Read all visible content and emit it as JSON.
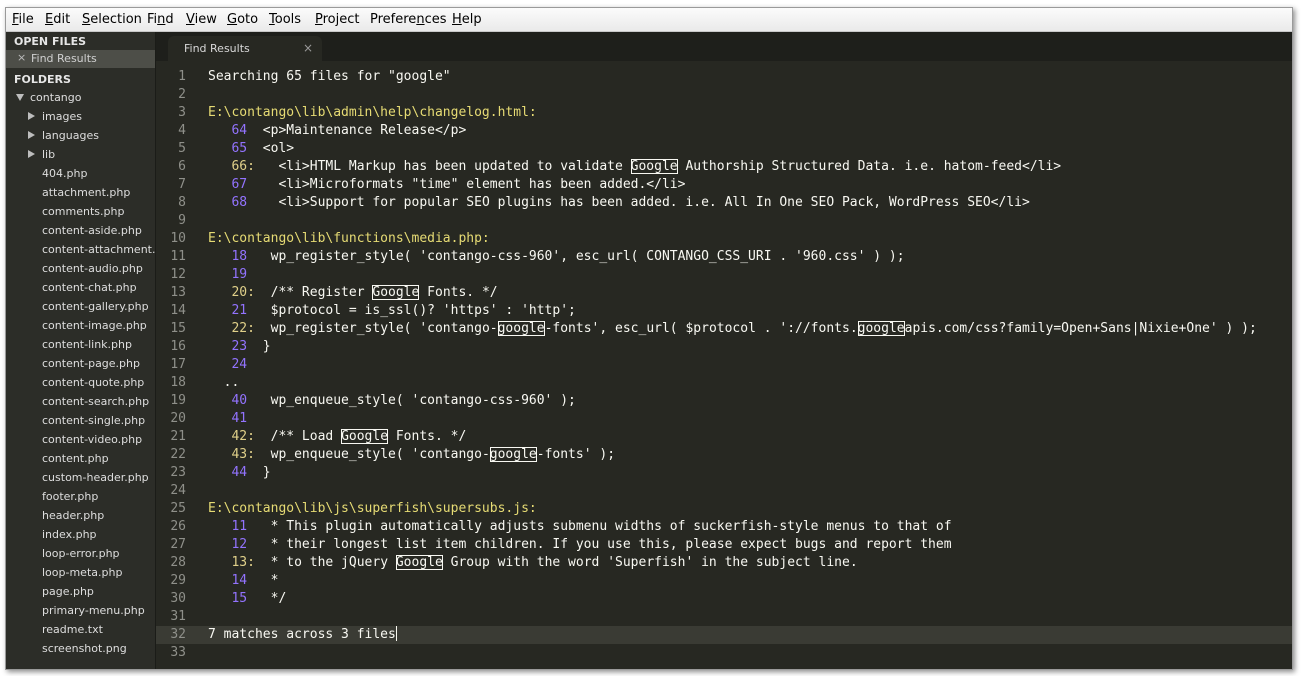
{
  "menubar": {
    "items": [
      "File",
      "Edit",
      "Selection",
      "Find",
      "View",
      "Goto",
      "Tools",
      "Project",
      "Preferences",
      "Help"
    ],
    "mnemonics": [
      "F",
      "E",
      "S",
      "n",
      "V",
      "G",
      "T",
      "P",
      "n",
      "H"
    ]
  },
  "sidebar": {
    "open_files_header": "OPEN FILES",
    "open_files": [
      {
        "close": "×",
        "name": "Find Results"
      }
    ],
    "folders_header": "FOLDERS",
    "root_folder": "contango",
    "subfolders": [
      "images",
      "languages",
      "lib"
    ],
    "files": [
      "404.php",
      "attachment.php",
      "comments.php",
      "content-aside.php",
      "content-attachment.php",
      "content-audio.php",
      "content-chat.php",
      "content-gallery.php",
      "content-image.php",
      "content-link.php",
      "content-page.php",
      "content-quote.php",
      "content-search.php",
      "content-single.php",
      "content-video.php",
      "content.php",
      "custom-header.php",
      "footer.php",
      "header.php",
      "index.php",
      "loop-error.php",
      "loop-meta.php",
      "page.php",
      "primary-menu.php",
      "readme.txt",
      "screenshot.png"
    ]
  },
  "tab": {
    "title": "Find Results",
    "close": "×"
  },
  "editor": {
    "current_line": 32,
    "colors": {
      "background": "#272822",
      "text": "#f8f8f2",
      "line_number": "#8f908a",
      "path": "#e6db74",
      "context_number": "#9373ff",
      "match_number": "#e0d08a",
      "current_line": "#3a3b34"
    },
    "lines": [
      {
        "n": "1",
        "t": [
          [
            "t",
            "Searching 65 files for \"google\""
          ]
        ]
      },
      {
        "n": "2",
        "t": []
      },
      {
        "n": "3",
        "t": [
          [
            "p",
            "E:\\contango\\lib\\admin\\help\\changelog.html:"
          ]
        ]
      },
      {
        "n": "4",
        "t": [
          [
            "c",
            "   64"
          ],
          [
            "t",
            "  <p>Maintenance Release</p>"
          ]
        ]
      },
      {
        "n": "5",
        "t": [
          [
            "c",
            "   65"
          ],
          [
            "t",
            "  <ol>"
          ]
        ]
      },
      {
        "n": "6",
        "t": [
          [
            "m",
            "   66:"
          ],
          [
            "t",
            "   <li>HTML Markup has been updated to validate "
          ],
          [
            "h",
            "Google"
          ],
          [
            "t",
            " Authorship Structured Data. i.e. hatom-feed</li>"
          ]
        ]
      },
      {
        "n": "7",
        "t": [
          [
            "c",
            "   67"
          ],
          [
            "t",
            "    <li>Microformats \"time\" element has been added.</li>"
          ]
        ]
      },
      {
        "n": "8",
        "t": [
          [
            "c",
            "   68"
          ],
          [
            "t",
            "    <li>Support for popular SEO plugins has been added. i.e. All In One SEO Pack, WordPress SEO</li>"
          ]
        ]
      },
      {
        "n": "9",
        "t": []
      },
      {
        "n": "10",
        "t": [
          [
            "p",
            "E:\\contango\\lib\\functions\\media.php:"
          ]
        ]
      },
      {
        "n": "11",
        "t": [
          [
            "c",
            "   18"
          ],
          [
            "t",
            "   wp_register_style( 'contango-css-960', esc_url( CONTANGO_CSS_URI . '960.css' ) );"
          ]
        ]
      },
      {
        "n": "12",
        "t": [
          [
            "c",
            "   19"
          ]
        ]
      },
      {
        "n": "13",
        "t": [
          [
            "m",
            "   20:"
          ],
          [
            "t",
            "  /** Register "
          ],
          [
            "h",
            "Google"
          ],
          [
            "t",
            " Fonts. */"
          ]
        ]
      },
      {
        "n": "14",
        "t": [
          [
            "c",
            "   21"
          ],
          [
            "t",
            "   $protocol = is_ssl()? 'https' : 'http';"
          ]
        ]
      },
      {
        "n": "15",
        "t": [
          [
            "m",
            "   22:"
          ],
          [
            "t",
            "  wp_register_style( 'contango-"
          ],
          [
            "h",
            "google"
          ],
          [
            "t",
            "-fonts', esc_url( $protocol . '://fonts."
          ],
          [
            "h",
            "google"
          ],
          [
            "t",
            "apis.com/css?family=Open+Sans|Nixie+One' ) );"
          ]
        ]
      },
      {
        "n": "16",
        "t": [
          [
            "c",
            "   23"
          ],
          [
            "t",
            "  }"
          ]
        ]
      },
      {
        "n": "17",
        "t": [
          [
            "c",
            "   24"
          ]
        ]
      },
      {
        "n": "18",
        "t": [
          [
            "t",
            "  .."
          ]
        ]
      },
      {
        "n": "19",
        "t": [
          [
            "c",
            "   40"
          ],
          [
            "t",
            "   wp_enqueue_style( 'contango-css-960' );"
          ]
        ]
      },
      {
        "n": "20",
        "t": [
          [
            "c",
            "   41"
          ]
        ]
      },
      {
        "n": "21",
        "t": [
          [
            "m",
            "   42:"
          ],
          [
            "t",
            "  /** Load "
          ],
          [
            "h",
            "Google"
          ],
          [
            "t",
            " Fonts. */"
          ]
        ]
      },
      {
        "n": "22",
        "t": [
          [
            "m",
            "   43:"
          ],
          [
            "t",
            "  wp_enqueue_style( 'contango-"
          ],
          [
            "h",
            "google"
          ],
          [
            "t",
            "-fonts' );"
          ]
        ]
      },
      {
        "n": "23",
        "t": [
          [
            "c",
            "   44"
          ],
          [
            "t",
            "  }"
          ]
        ]
      },
      {
        "n": "24",
        "t": []
      },
      {
        "n": "25",
        "t": [
          [
            "p",
            "E:\\contango\\lib\\js\\superfish\\supersubs.js:"
          ]
        ]
      },
      {
        "n": "26",
        "t": [
          [
            "c",
            "   11"
          ],
          [
            "t",
            "   * This plugin automatically adjusts submenu widths of suckerfish-style menus to that of"
          ]
        ]
      },
      {
        "n": "27",
        "t": [
          [
            "c",
            "   12"
          ],
          [
            "t",
            "   * their longest list item children. If you use this, please expect bugs and report them"
          ]
        ]
      },
      {
        "n": "28",
        "t": [
          [
            "m",
            "   13:"
          ],
          [
            "t",
            "  * to the jQuery "
          ],
          [
            "h",
            "Google"
          ],
          [
            "t",
            " Group with the word 'Superfish' in the subject line."
          ]
        ]
      },
      {
        "n": "29",
        "t": [
          [
            "c",
            "   14"
          ],
          [
            "t",
            "   *"
          ]
        ]
      },
      {
        "n": "30",
        "t": [
          [
            "c",
            "   15"
          ],
          [
            "t",
            "   */"
          ]
        ]
      },
      {
        "n": "31",
        "t": []
      },
      {
        "n": "32",
        "t": [
          [
            "t",
            "7 matches across 3 files"
          ]
        ]
      },
      {
        "n": "33",
        "t": []
      }
    ]
  }
}
